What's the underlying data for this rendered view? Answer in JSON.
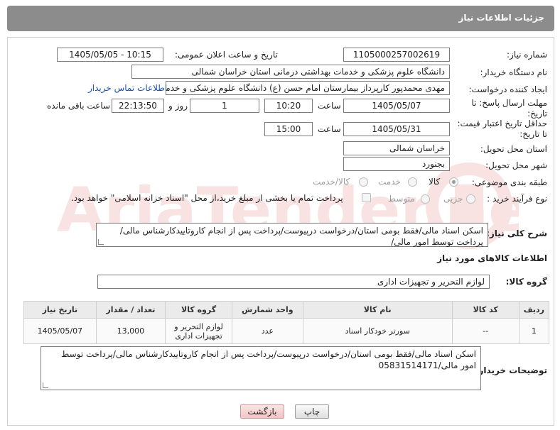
{
  "header": {
    "title": "جزئیات اطلاعات نیاز"
  },
  "form": {
    "need_number_label": "شماره نیاز:",
    "need_number": "1105000257002619",
    "announce_label": "تاریخ و ساعت اعلان عمومی:",
    "announce_value": "1405/05/05 - 10:15",
    "buyer_org_label": "نام دستگاه خریدار:",
    "buyer_org": "دانشگاه علوم پزشکی و خدمات بهداشتی درمانی استان خراسان شمالی",
    "requester_label": "ایجاد کننده درخواست:",
    "requester": "مهدی محمدپور کارپرداز بیمارستان امام حسن (ع) دانشگاه علوم پزشکی و خدمات",
    "contact_link": "اطلاعات تماس خریدار",
    "deadline_label": "مهلت ارسال پاسخ: تا تاریخ:",
    "deadline_date": "1405/05/07",
    "time_label": "ساعت",
    "deadline_time": "10:20",
    "days_value": "1",
    "days_label": "روز و",
    "remaining_time": "22:13:50",
    "remaining_label": "ساعت باقی مانده",
    "price_validity_label": "حداقل تاریخ اعتبار قیمت: تا تاریخ:",
    "price_validity_date": "1405/05/31",
    "price_validity_time": "15:00",
    "province_label": "استان محل تحویل:",
    "province": "خراسان شمالی",
    "city_label": "شهر محل تحویل:",
    "city": "بجنورد",
    "category_label": "طبقه بندی موضوعی:",
    "category_options": [
      "کالا",
      "خدمت",
      "کالا/خدمت"
    ],
    "category_selected": "کالا",
    "process_label": "نوع فرآیند خرید :",
    "process_options": [
      "جزیی",
      "متوسط"
    ],
    "payment_note": "پرداخت تمام یا بخشی از مبلغ خرید،از محل \"اسناد خزانه اسلامی\" خواهد بود."
  },
  "description": {
    "label": "شرح کلی نیاز:",
    "text": "اسکن اسناد مالی/فقط بومی استان/درخواست درپیوست/پرداخت پس از انجام کاروتاییدکارشناس مالی/پرداخت توسط امور مالی/"
  },
  "goods": {
    "section_title": "اطلاعات کالاهای مورد نیاز",
    "group_label": "گروه کالا:",
    "group_value": "لوازم التحریر و تجهیزات اداری",
    "columns": [
      "ردیف",
      "کد کالا",
      "نام کالا",
      "واحد شمارش",
      "گروه کالا",
      "تعداد / مقدار",
      "تاریخ نیاز"
    ],
    "rows": [
      {
        "index": "1",
        "code": "--",
        "name": "سورتر خودکار اسناد",
        "unit": "عدد",
        "group": "لوازم التحریر و تجهیزات اداری",
        "quantity": "13,000",
        "date": "1405/05/07"
      }
    ]
  },
  "buyer_notes": {
    "label": "توضیحات خریدار:",
    "text": "اسکن اسناد مالی/فقط بومی استان/درخواست درپیوست/پرداخت پس از انجام کاروتاییدکارشناس مالی/پرداخت توسط امور مالی/05831514171"
  },
  "buttons": {
    "print": "چاپ",
    "back": "بازگشت"
  },
  "watermark": {
    "text": "AriaTender.net"
  }
}
